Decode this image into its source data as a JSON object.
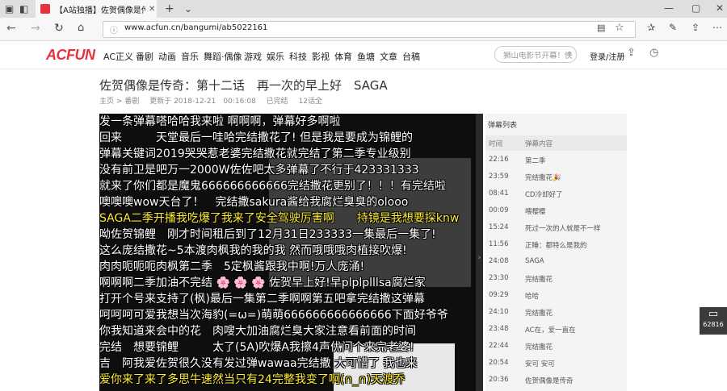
{
  "browser": {
    "tab_title": "【A站独播】佐贺偶像是传",
    "url": "www.acfun.cn/bangumi/ab5022161"
  },
  "site": {
    "logo": "ACFUN",
    "nav": [
      "AC正义",
      "番剧",
      "动画",
      "音乐",
      "舞蹈·偶像",
      "游戏",
      "娱乐",
      "科技",
      "影视",
      "体育",
      "鱼塘",
      "文章",
      "台稿"
    ],
    "search_placeholder": "狮山电影节开幕！快",
    "login": "登录/注册"
  },
  "page": {
    "title": "佐贺偶像是传奇：第十二话　再一次的早上好　SAGA",
    "breadcrumb": [
      "主页",
      ">",
      "番剧"
    ],
    "updated": "更新于 2018-12-21　00:16:08",
    "status": "已完结",
    "episodes": "12话全"
  },
  "danmaku_lines": [
    {
      "text": "发一条弹幕嗒哈哈我来啦 啊啊啊，弹幕好多啊啦",
      "color": "#ffffff"
    },
    {
      "text": "回来　　　天堂最后一哇哈完结撒花了! 但是我是要成为锦鲤的",
      "color": "#ffffff"
    },
    {
      "text": "弹幕关键词2019哭哭惹老婆完结撒花就完结了第二季专业级别",
      "color": "#ffffff"
    },
    {
      "text": "没有前卫是吧万一2000W佐佐吧太多弹幕了不行于423331333",
      "color": "#ffffff"
    },
    {
      "text": "就来了你们都是魔鬼666666666666完结撒花更别了！！！有完结啦",
      "color": "#ffffff"
    },
    {
      "text": "噢噢噢wow天台了！　完结撒sakura酱给我腐烂臭臭的olooo",
      "color": "#ffffff"
    },
    {
      "text": "SAGA二季开播我吃爆了我来了安全驾驶厉害啊　　持镜是我想要探knw",
      "color": "#ffee33"
    },
    {
      "text": "呦佐贺锦鲤　刚才时间租后到了12月31日233333一集最后一集了!",
      "color": "#ffffff"
    },
    {
      "text": "这么庞结撒花~5本渡肉枫我的我的我 然而哦哦哦肉植接吹爆!",
      "color": "#ffffff"
    },
    {
      "text": "肉肉呃呃呃肉枫第二季　5定枫酱跟我中啊!万人庞涌!",
      "color": "#ffffff"
    },
    {
      "text": "啊啊啊二季加油不完结 🌸 🌸 🌸 佐贺早上好!早plplplllsa腐烂家",
      "color": "#ffffff"
    },
    {
      "text": "打开个号来支持了(枫)最后一集第二季啊啊第五吧拿完结撒这弹幕",
      "color": "#ffffff"
    },
    {
      "text": "呵呵呵可爱我想当次海豹(=ω=)萌萌666666666666666下面好爷爷",
      "color": "#ffffff"
    },
    {
      "text": "你我知道来会中的花　肉嗖大加油腐烂臭大家注意看前面的时间",
      "color": "#ffffff"
    },
    {
      "text": "完结　想要锦鲤　　　太了(5A)吹爆A我擦4声优问个来完老婆!",
      "color": "#ffffff"
    },
    {
      "text": "吉　阿我爱佐贺很久没有发过弹wawaa完结撒 大可惜了 我也来",
      "color": "#ffffff"
    },
    {
      "text": "爱你来了来了多思牛速然当只有24完整我变了啊(∩_∩)天渡乔",
      "color": "#ffee33"
    }
  ],
  "danmaku_list": {
    "header": "弹幕列表",
    "col_time": "时间",
    "col_content": "弹幕内容",
    "rows": [
      {
        "time": "22:16",
        "content": "第二季"
      },
      {
        "time": "23:59",
        "content": "完结撒花🎉"
      },
      {
        "time": "08:41",
        "content": "CD冷却好了"
      },
      {
        "time": "00:09",
        "content": "喂樱樱"
      },
      {
        "time": "15:24",
        "content": "死过一次的人就是不一样"
      },
      {
        "time": "11:56",
        "content": "正睡：都特么是我的"
      },
      {
        "time": "24:08",
        "content": "SAGA"
      },
      {
        "time": "23:30",
        "content": "完结撒花"
      },
      {
        "time": "09:29",
        "content": "哈哈"
      },
      {
        "time": "24:10",
        "content": "完结撒花"
      },
      {
        "time": "23:48",
        "content": "AC在，爱一直在"
      },
      {
        "time": "22:44",
        "content": "完结撒花"
      },
      {
        "time": "20:54",
        "content": "安可 安可"
      },
      {
        "time": "20:36",
        "content": "佐贺偶像是传奇"
      }
    ]
  },
  "chat_count": "62816"
}
